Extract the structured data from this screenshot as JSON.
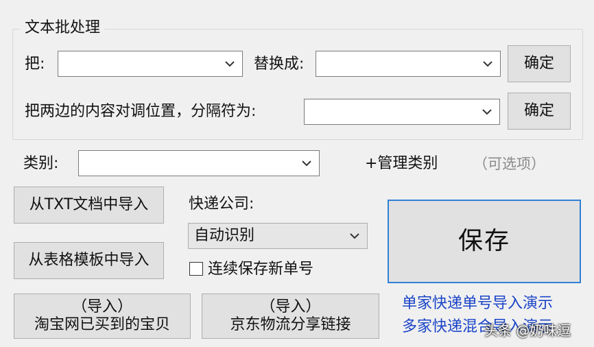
{
  "batch_group": {
    "title": "文本批处理",
    "from_label": "把:",
    "to_label": "替换成:",
    "confirm_label": "确定",
    "swap_label": "把两边的内容对调位置，分隔符为:",
    "swap_confirm_label": "确定"
  },
  "category": {
    "label": "类别:",
    "manage_label": "+管理类别",
    "optional_hint": "（可选项）"
  },
  "import_txt_label": "从TXT文档中导入",
  "import_template_label": "从表格模板中导入",
  "courier": {
    "label": "快递公司:",
    "selected": "自动识别",
    "continuous_save_label": "连续保存新单号"
  },
  "save_label": "保存",
  "import_taobao": {
    "line1": "（导入）",
    "line2": "淘宝网已买到的宝贝"
  },
  "import_jd": {
    "line1": "（导入）",
    "line2": "京东物流分享链接"
  },
  "demo_links": {
    "single": "单家快递单号导入演示",
    "multi": "多家快递混合导入演示"
  },
  "watermark": "头条 @奶味逗"
}
